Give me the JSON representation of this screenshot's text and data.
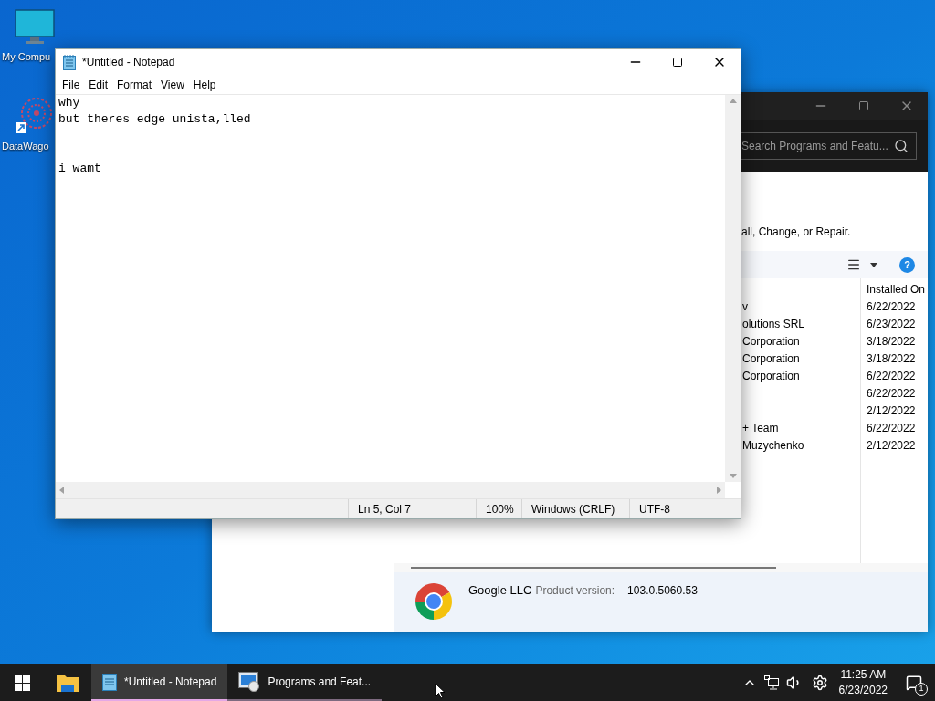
{
  "desktop_icons": [
    {
      "label": "My Compu",
      "kind": "computer"
    },
    {
      "label": "DataWago",
      "kind": "shortcut"
    }
  ],
  "programs_window": {
    "search": {
      "placeholder": "Search Programs and Featu..."
    },
    "instructions": "all, Change, or Repair.",
    "help_label": "?",
    "table": {
      "columns": [
        "Installed On"
      ],
      "rows": [
        {
          "publisher": "v",
          "installed_on": "6/22/2022"
        },
        {
          "publisher": "olutions SRL",
          "installed_on": "6/23/2022"
        },
        {
          "publisher": "Corporation",
          "installed_on": "3/18/2022"
        },
        {
          "publisher": "Corporation",
          "installed_on": "3/18/2022"
        },
        {
          "publisher": "Corporation",
          "installed_on": "6/22/2022"
        },
        {
          "installed_on": "6/22/2022"
        },
        {
          "installed_on": "2/12/2022"
        },
        {
          "publisher": "+ Team",
          "installed_on": "6/22/2022"
        },
        {
          "publisher": "Muzychenko",
          "installed_on": "2/12/2022"
        }
      ]
    },
    "details": {
      "publisher": "Google LLC",
      "label": "Product version:",
      "value": "103.0.5060.53"
    }
  },
  "notepad": {
    "title": "*Untitled - Notepad",
    "menu": [
      "File",
      "Edit",
      "Format",
      "View",
      "Help"
    ],
    "text": "why\nbut theres edge unista,lled\n\n\ni wamt",
    "status": [
      "Ln 5, Col 7",
      "100%",
      "Windows (CRLF)",
      "UTF-8"
    ]
  },
  "taskbar": {
    "items": [
      {
        "kind": "explorer",
        "selected": false
      },
      {
        "kind": "notepad",
        "label": "*Untitled - Notepad",
        "selected": true
      },
      {
        "kind": "programs",
        "label": "Programs and Feat...",
        "selected": false
      }
    ],
    "time": "11:25 AM",
    "date": "6/23/2022",
    "notification_count": "1"
  }
}
